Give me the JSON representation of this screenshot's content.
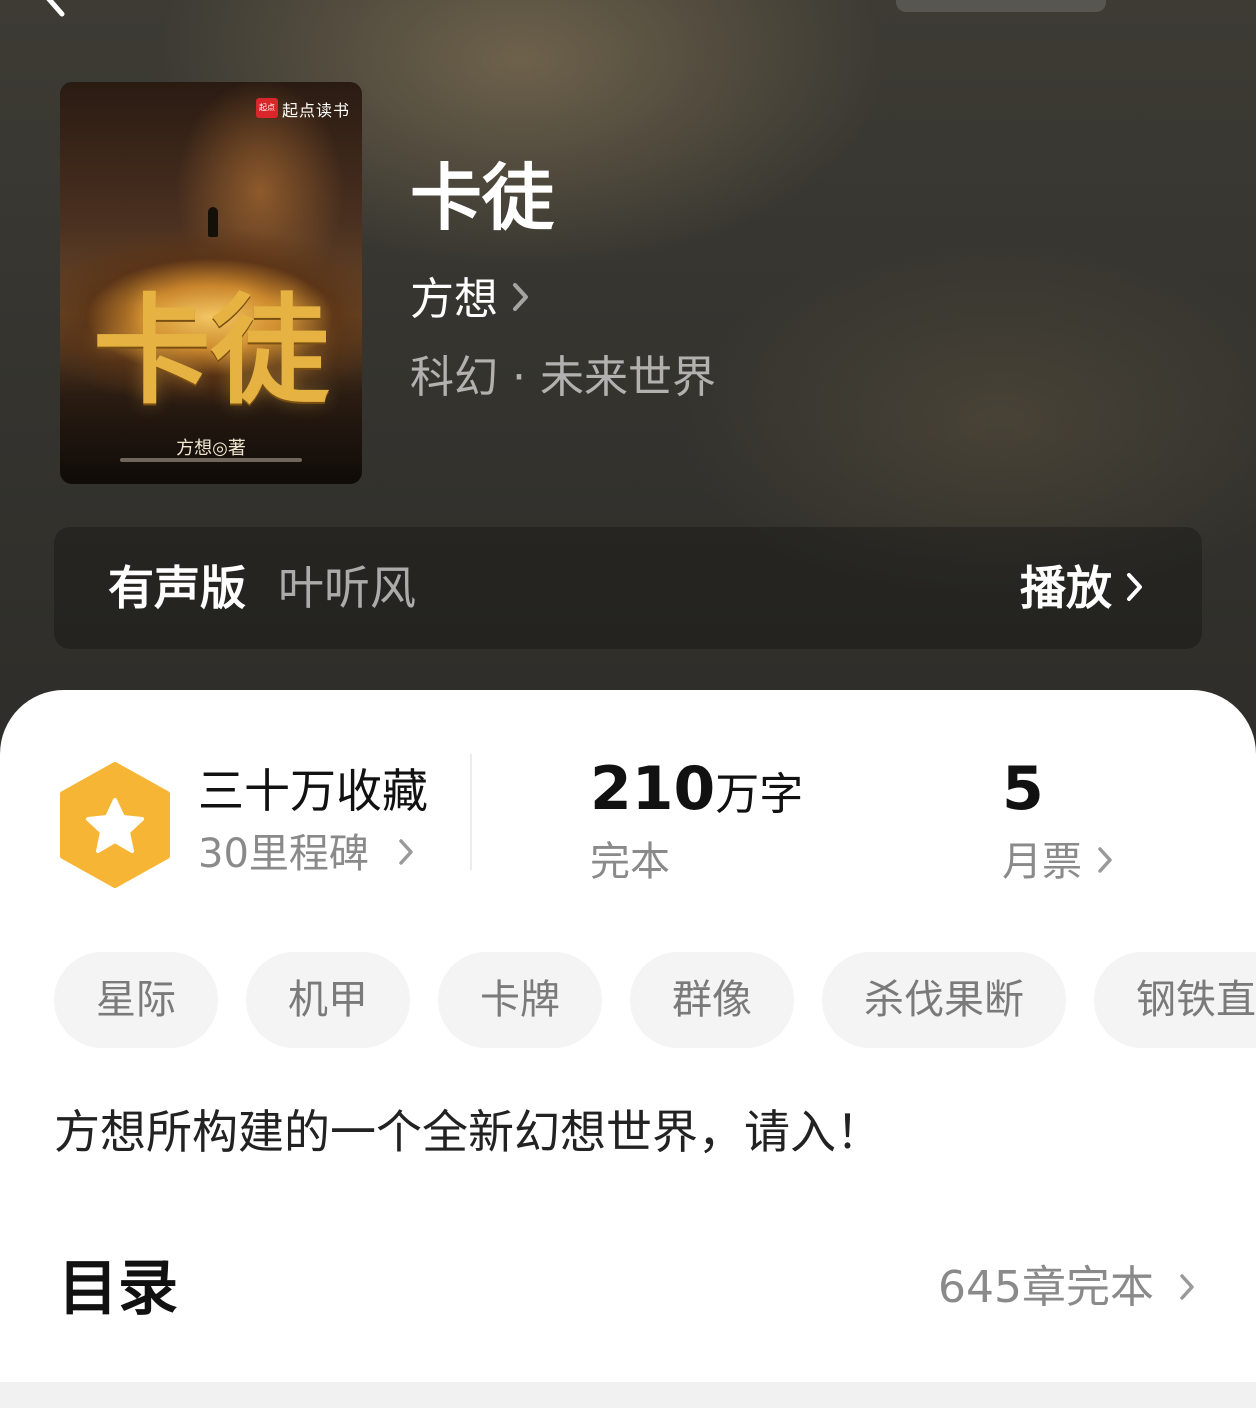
{
  "cover": {
    "logo_mark": "起点",
    "logo_text": "起点读书",
    "title": "卡徒",
    "author": "方想◎著"
  },
  "book": {
    "title": "卡徒",
    "author": "方想",
    "genre": "科幻 · 未来世界"
  },
  "audio": {
    "label": "有声版",
    "narrator": "叶听风",
    "play": "播放"
  },
  "stats": {
    "collection_title": "三十万收藏",
    "collection_sub": "30里程碑",
    "words_number": "210",
    "words_unit": "万字",
    "words_sub": "完本",
    "monthly_votes": "5",
    "monthly_label": "月票"
  },
  "tags": [
    "星际",
    "机甲",
    "卡牌",
    "群像",
    "杀伐果断",
    "钢铁直"
  ],
  "description": "方想所构建的一个全新幻想世界，请入！",
  "toc": {
    "title": "目录",
    "info": "645章完本"
  },
  "colors": {
    "badge": "#f7b535",
    "accent_text": "#111111",
    "muted": "#8a8a8a"
  }
}
